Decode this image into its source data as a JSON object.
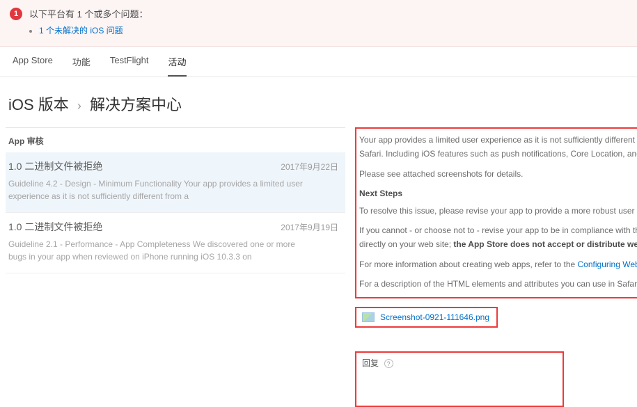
{
  "alert": {
    "badge": "1",
    "title": "以下平台有 1 个或多个问题：",
    "items": [
      {
        "label": "1 个未解决的 iOS 问题"
      }
    ]
  },
  "tabs": [
    {
      "label": "App Store",
      "active": false
    },
    {
      "label": "功能",
      "active": false
    },
    {
      "label": "TestFlight",
      "active": false
    },
    {
      "label": "活动",
      "active": true
    }
  ],
  "breadcrumb": {
    "seg1": "iOS 版本",
    "seg2": "解决方案中心"
  },
  "left": {
    "heading": "App 审核",
    "items": [
      {
        "title": "1.0 二进制文件被拒绝",
        "date": "2017年9月22日",
        "body": "Guideline 4.2 - Design - Minimum Functionality Your app provides a limited user experience as it is not sufficiently different from a",
        "selected": true
      },
      {
        "title": "1.0 二进制文件被拒绝",
        "date": "2017年9月19日",
        "body": "Guideline 2.1 - Performance - App Completeness We discovered one or more bugs in your app when reviewed on iPhone running iOS 10.3.3 on",
        "selected": false
      }
    ]
  },
  "detail": {
    "line1": "Your app provides a limited user experience as it is not sufficiently different from a",
    "line2": "Safari. Including iOS features such as push notifications, Core Location, and sharin",
    "line3": "Please see attached screenshots for details.",
    "next_steps": "Next Steps",
    "line4": "To resolve this issue, please revise your app to provide a more robust user experien",
    "line5a": "If you cannot - or choose not to - revise your app to be in compliance with the app",
    "line5b_prefix": "directly on your web site; ",
    "line5b_strong": "the App Store does not accept or distribute web apps.",
    "line6_prefix": "For more information about creating web apps, refer to the ",
    "line6_link": "Configuring Web Applic",
    "line7": "For a description of the HTML elements and attributes you can use in Safari on iPh"
  },
  "attachment": {
    "filename": "Screenshot-0921-111646.png"
  },
  "reply": {
    "label": "回复",
    "help": "?"
  }
}
